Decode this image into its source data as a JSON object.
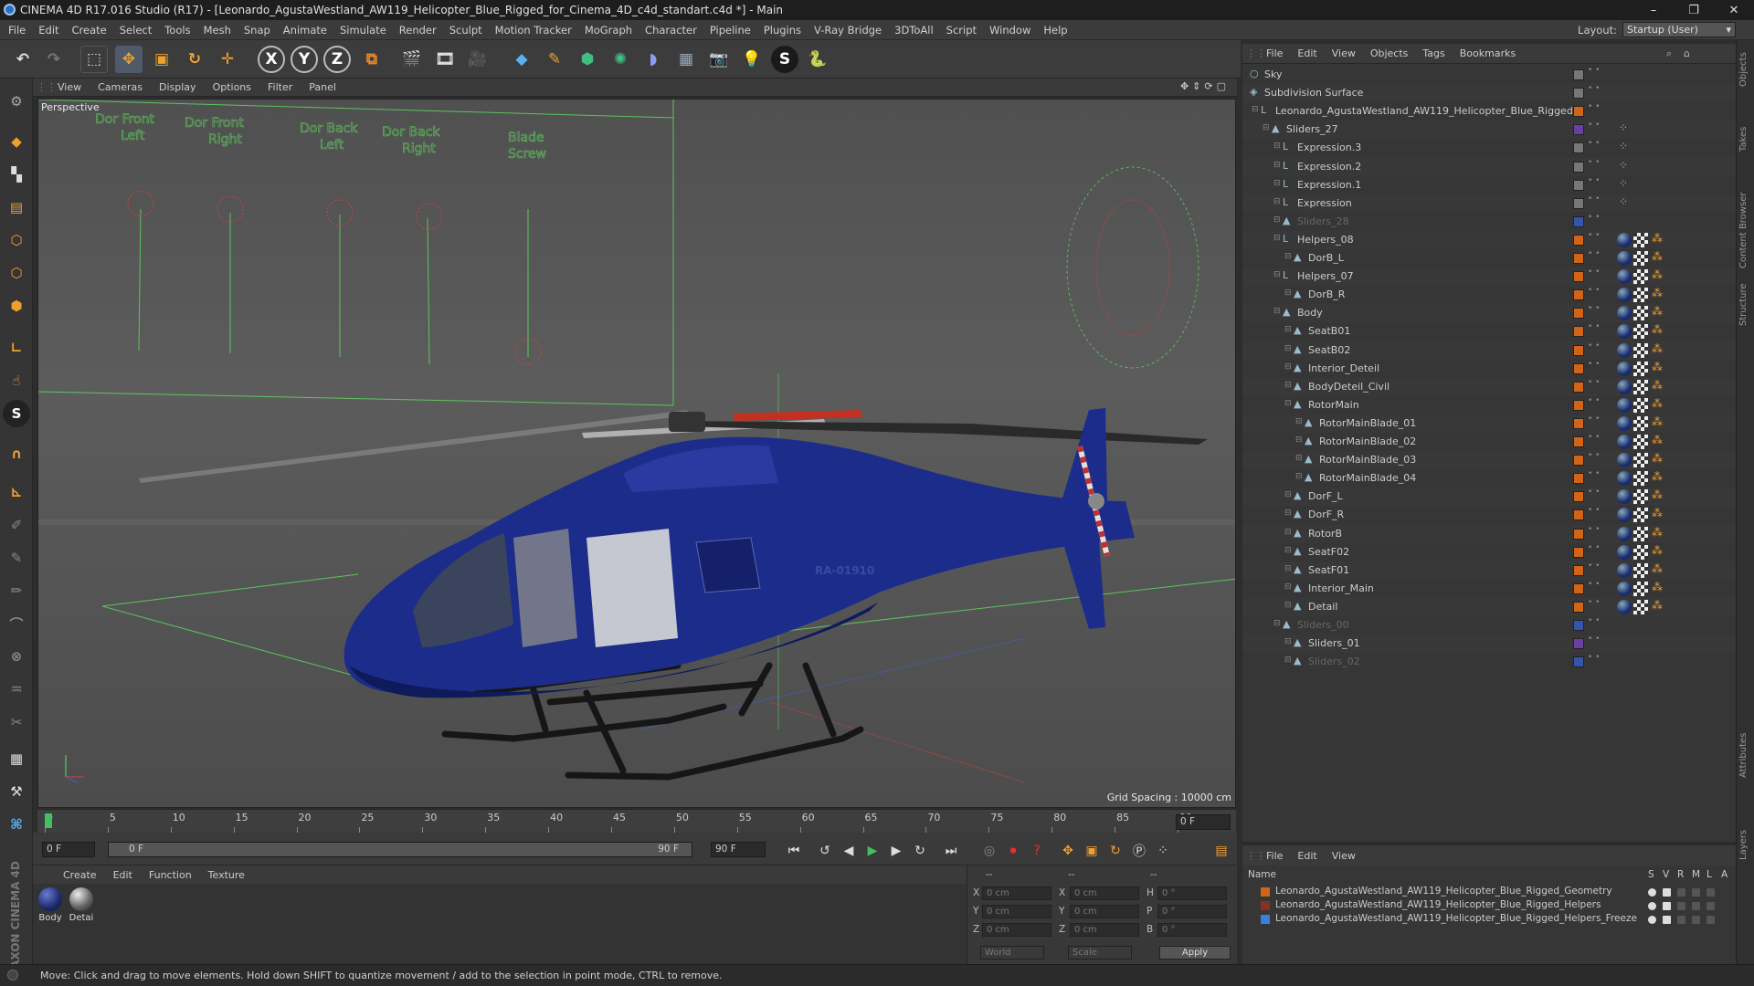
{
  "window": {
    "title": "CINEMA 4D R17.016 Studio (R17) - [Leonardo_AgustaWestland_AW119_Helicopter_Blue_Rigged_for_Cinema_4D_c4d_standart.c4d *] - Main",
    "controls": [
      "–",
      "❐",
      "✕"
    ]
  },
  "menubar": {
    "items": [
      "File",
      "Edit",
      "Create",
      "Select",
      "Tools",
      "Mesh",
      "Snap",
      "Animate",
      "Simulate",
      "Render",
      "Sculpt",
      "Motion Tracker",
      "MoGraph",
      "Character",
      "Pipeline",
      "Plugins",
      "V-Ray Bridge",
      "3DToAll",
      "Script",
      "Window",
      "Help"
    ],
    "layout_label": "Layout:",
    "layout_value": "Startup (User)"
  },
  "toolbar": {
    "axis_x": "X",
    "axis_y": "Y",
    "axis_z": "Z"
  },
  "viewport": {
    "menu": [
      "View",
      "Cameras",
      "Display",
      "Options",
      "Filter",
      "Panel"
    ],
    "camera_label": "Perspective",
    "grid_spacing": "Grid Spacing : 10000 cm",
    "rig_labels": [
      "Dor Front Left",
      "Dor Front Right",
      "Dor Back Left",
      "Dor Back Right",
      "Blade Screw"
    ],
    "reg_number": "RA-01910"
  },
  "timeline": {
    "ticks": [
      "0",
      "5",
      "10",
      "15",
      "20",
      "25",
      "30",
      "35",
      "40",
      "45",
      "50",
      "55",
      "60",
      "65",
      "70",
      "75",
      "80",
      "85",
      "90"
    ],
    "current_frame_display": "0 F",
    "start_field": "0 F",
    "range_start": "0 F",
    "range_end": "90 F",
    "end_field": "90 F"
  },
  "material_manager": {
    "menu": [
      "Create",
      "Edit",
      "Function",
      "Texture"
    ],
    "materials": [
      {
        "name": "Body",
        "color": "#1b2a6e"
      },
      {
        "name": "Detai",
        "color": "#666666"
      }
    ]
  },
  "coordinates": {
    "header_left": "--",
    "header_mid": "--",
    "header_right": "--",
    "rows": [
      {
        "axis": "X",
        "pos": "0 cm",
        "axis2": "X",
        "size": "0 cm",
        "rot_axis": "H",
        "rot": "0 °"
      },
      {
        "axis": "Y",
        "pos": "0 cm",
        "axis2": "Y",
        "size": "0 cm",
        "rot_axis": "P",
        "rot": "0 °"
      },
      {
        "axis": "Z",
        "pos": "0 cm",
        "axis2": "Z",
        "size": "0 cm",
        "rot_axis": "B",
        "rot": "0 °"
      }
    ],
    "mode_world": "World",
    "mode_scale": "Scale",
    "apply": "Apply"
  },
  "brand": "MAXON CINEMA 4D",
  "status": "Move: Click and drag to move elements. Hold down SHIFT to quantize movement / add to the selection in point mode, CTRL to remove.",
  "object_manager": {
    "menu": [
      "File",
      "Edit",
      "View",
      "Objects",
      "Tags",
      "Bookmarks"
    ],
    "rows": [
      {
        "name": "Sky",
        "indent": 0,
        "dim": false,
        "color": "#777777",
        "icon": "sky"
      },
      {
        "name": "Subdivision Surface",
        "indent": 0,
        "dim": false,
        "color": "#777777",
        "icon": "subdiv"
      },
      {
        "name": "Leonardo_AgustaWestland_AW119_Helicopter_Blue_Rigged",
        "indent": 1,
        "dim": false,
        "color": "#d0651a",
        "icon": "null"
      },
      {
        "name": "Sliders_27",
        "indent": 2,
        "dim": false,
        "color": "#6a3fa0",
        "icon": "poly"
      },
      {
        "name": "Expression.3",
        "indent": 3,
        "dim": false,
        "color": "#777777",
        "icon": "null"
      },
      {
        "name": "Expression.2",
        "indent": 3,
        "dim": false,
        "color": "#777777",
        "icon": "null"
      },
      {
        "name": "Expression.1",
        "indent": 3,
        "dim": false,
        "color": "#777777",
        "icon": "null"
      },
      {
        "name": "Expression",
        "indent": 3,
        "dim": false,
        "color": "#777777",
        "icon": "null"
      },
      {
        "name": "Sliders_28",
        "indent": 3,
        "dim": true,
        "color": "#3355aa",
        "icon": "poly"
      },
      {
        "name": "Helpers_08",
        "indent": 3,
        "dim": false,
        "color": "#d0651a",
        "icon": "null"
      },
      {
        "name": "DorB_L",
        "indent": 4,
        "dim": false,
        "color": "#d0651a",
        "icon": "poly"
      },
      {
        "name": "Helpers_07",
        "indent": 3,
        "dim": false,
        "color": "#d0651a",
        "icon": "null"
      },
      {
        "name": "DorB_R",
        "indent": 4,
        "dim": false,
        "color": "#d0651a",
        "icon": "poly"
      },
      {
        "name": "Body",
        "indent": 3,
        "dim": false,
        "color": "#d0651a",
        "icon": "poly"
      },
      {
        "name": "SeatB01",
        "indent": 4,
        "dim": false,
        "color": "#d0651a",
        "icon": "poly"
      },
      {
        "name": "SeatB02",
        "indent": 4,
        "dim": false,
        "color": "#d0651a",
        "icon": "poly"
      },
      {
        "name": "Interior_Deteil",
        "indent": 4,
        "dim": false,
        "color": "#d0651a",
        "icon": "poly"
      },
      {
        "name": "BodyDeteil_Civil",
        "indent": 4,
        "dim": false,
        "color": "#d0651a",
        "icon": "poly"
      },
      {
        "name": "RotorMain",
        "indent": 4,
        "dim": false,
        "color": "#d0651a",
        "icon": "poly"
      },
      {
        "name": "RotorMainBlade_01",
        "indent": 5,
        "dim": false,
        "color": "#d0651a",
        "icon": "poly"
      },
      {
        "name": "RotorMainBlade_02",
        "indent": 5,
        "dim": false,
        "color": "#d0651a",
        "icon": "poly"
      },
      {
        "name": "RotorMainBlade_03",
        "indent": 5,
        "dim": false,
        "color": "#d0651a",
        "icon": "poly"
      },
      {
        "name": "RotorMainBlade_04",
        "indent": 5,
        "dim": false,
        "color": "#d0651a",
        "icon": "poly"
      },
      {
        "name": "DorF_L",
        "indent": 4,
        "dim": false,
        "color": "#d0651a",
        "icon": "poly"
      },
      {
        "name": "DorF_R",
        "indent": 4,
        "dim": false,
        "color": "#d0651a",
        "icon": "poly"
      },
      {
        "name": "RotorB",
        "indent": 4,
        "dim": false,
        "color": "#d0651a",
        "icon": "poly"
      },
      {
        "name": "SeatF02",
        "indent": 4,
        "dim": false,
        "color": "#d0651a",
        "icon": "poly"
      },
      {
        "name": "SeatF01",
        "indent": 4,
        "dim": false,
        "color": "#d0651a",
        "icon": "poly"
      },
      {
        "name": "Interior_Main",
        "indent": 4,
        "dim": false,
        "color": "#d0651a",
        "icon": "poly"
      },
      {
        "name": "Detail",
        "indent": 4,
        "dim": false,
        "color": "#d0651a",
        "icon": "poly"
      },
      {
        "name": "Sliders_00",
        "indent": 3,
        "dim": true,
        "color": "#3355aa",
        "icon": "poly"
      },
      {
        "name": "Sliders_01",
        "indent": 4,
        "dim": false,
        "color": "#6a3fa0",
        "icon": "poly"
      },
      {
        "name": "Sliders_02",
        "indent": 4,
        "dim": true,
        "color": "#3355aa",
        "icon": "poly"
      }
    ]
  },
  "layer_manager": {
    "menu": [
      "File",
      "Edit",
      "View"
    ],
    "columns": [
      "Name",
      "S",
      "V",
      "R",
      "M",
      "L",
      "A"
    ],
    "layers": [
      {
        "name": "Leonardo_AgustaWestland_AW119_Helicopter_Blue_Rigged_Geometry",
        "color": "#d0651a"
      },
      {
        "name": "Leonardo_AgustaWestland_AW119_Helicopter_Blue_Rigged_Helpers",
        "color": "#8a3020"
      },
      {
        "name": "Leonardo_AgustaWestland_AW119_Helicopter_Blue_Rigged_Helpers_Freeze",
        "color": "#3a7fdd"
      }
    ]
  },
  "right_strip": [
    "Objects",
    "Takes",
    "Content Browser",
    "Structure",
    "Attributes",
    "Layers"
  ]
}
